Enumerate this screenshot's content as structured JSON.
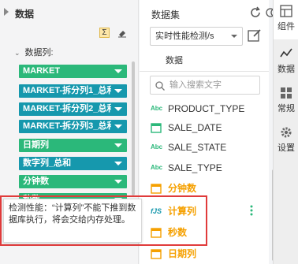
{
  "left_panel": {
    "title": "数据",
    "sigma_label": "Σ",
    "fields_row_label": "数据列:",
    "pills": [
      {
        "label": "MARKET",
        "color": "green"
      },
      {
        "label": "MARKET-拆分列1_总和",
        "color": "teal"
      },
      {
        "label": "MARKET-拆分列2_总和",
        "color": "teal"
      },
      {
        "label": "MARKET-拆分列3_总和",
        "color": "teal"
      },
      {
        "label": "日期列",
        "color": "green"
      },
      {
        "label": "数字列_总和",
        "color": "teal"
      },
      {
        "label": "分钟数",
        "color": "green"
      },
      {
        "label": "秒数",
        "color": "green"
      }
    ]
  },
  "dataset_panel": {
    "title": "数据集",
    "dataset_value": "实时性能检测/s",
    "tab_label": "数据",
    "search_placeholder": "输入搜索文字",
    "fields": [
      {
        "label": "PRODUCT_TYPE",
        "kind": "abc",
        "icon_text": "Abc"
      },
      {
        "label": "SALE_DATE",
        "kind": "calendar",
        "icon_text": ""
      },
      {
        "label": "SALE_STATE",
        "kind": "abc",
        "icon_text": "Abc"
      },
      {
        "label": "SALE_TYPE",
        "kind": "abc",
        "icon_text": "Abc"
      },
      {
        "label": "分钟数",
        "kind": "calendar-calc",
        "icon_text": ""
      },
      {
        "label": "计算列",
        "kind": "fx",
        "icon_text": "fJS"
      },
      {
        "label": "秒数",
        "kind": "calendar-calc",
        "icon_text": ""
      },
      {
        "label": "日期列",
        "kind": "calendar-calc",
        "icon_text": ""
      }
    ]
  },
  "right_nav": [
    {
      "label": "组件",
      "icon": "component-icon",
      "active": true
    },
    {
      "label": "数据",
      "icon": "data-icon",
      "active": false
    },
    {
      "label": "常规",
      "icon": "grid-icon",
      "active": false
    },
    {
      "label": "设置",
      "icon": "gear-icon",
      "active": false
    }
  ],
  "tooltip": {
    "text": "检测性能：“计算列”不能下推到数据库执行，将会交给内存处理。"
  },
  "colors": {
    "green": "#2bb87a",
    "teal": "#1698ad",
    "orange": "#f5a000",
    "highlight_border": "#e03b3b"
  }
}
